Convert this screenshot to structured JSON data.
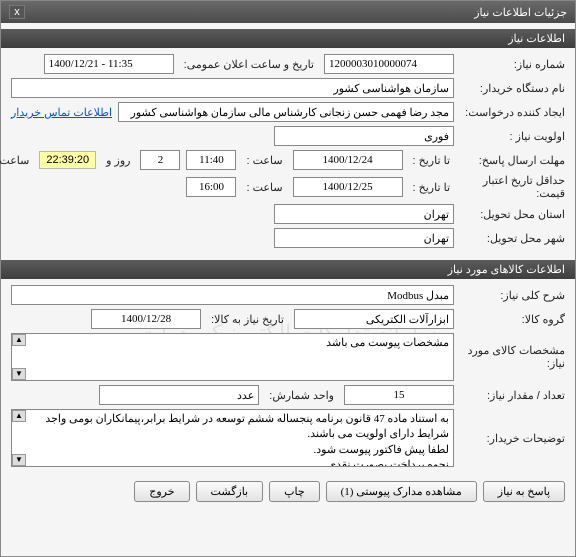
{
  "window": {
    "title": "جزئیات اطلاعات نیاز",
    "close": "x"
  },
  "section1": {
    "title": "اطلاعات نیاز"
  },
  "fields": {
    "need_no_label": "شماره نیاز:",
    "need_no": "1200003010000074",
    "announce_label": "تاریخ و ساعت اعلان عمومی:",
    "announce": "1400/12/21 - 11:35",
    "org_label": "نام دستگاه خریدار:",
    "org": "سازمان هواشناسی کشور",
    "requester_label": "ایجاد کننده درخواست:",
    "requester": "مجد رضا فهمی حسن زنجانی کارشناس مالی سازمان هواشناسی کشور",
    "contact_link": "اطلاعات تماس خریدار",
    "priority_label": "اولویت نیاز :",
    "priority": "فوری",
    "deadline_send_label": "مهلت ارسال پاسخ:",
    "to_date_label": "تا تاریخ :",
    "deadline_date": "1400/12/24",
    "time_label": "ساعت :",
    "deadline_time": "11:40",
    "days": "2",
    "days_and": "روز و",
    "countdown": "22:39:20",
    "remain_label": "ساعت باقی مانده",
    "valid_label": "حداقل تاریخ اعتبار قیمت:",
    "valid_date": "1400/12/25",
    "valid_time": "16:00",
    "deliver_province_label": "استان محل تحویل:",
    "deliver_province": "تهران",
    "deliver_city_label": "شهر محل تحویل:",
    "deliver_city": "تهران"
  },
  "section2": {
    "title": "اطلاعات کالاهای مورد نیاز"
  },
  "goods": {
    "desc_label": "شرح کلی نیاز:",
    "desc": "مبدل Modbus",
    "group_label": "گروه کالا:",
    "group": "ابزارآلات الکتریکی",
    "need_date_label": "تاریخ نیاز به کالا:",
    "need_date": "1400/12/28",
    "spec_label": "مشخصات کالای مورد نیاز:",
    "spec": "مشخصات پیوست می باشد",
    "qty_label": "تعداد / مقدار نیاز:",
    "qty": "15",
    "unit_label": "واحد شمارش:",
    "unit": "عدد",
    "buyer_notes_label": "توضیحات خریدار:",
    "buyer_notes": "به استناد ماده 47 قانون برنامه پنجساله ششم توسعه در شرایط برابر،پیمانکاران بومی واجد شرایط دارای اولویت می باشند.\nلطفا پیش فاکتور پیوست شود.\nنحوه پرداخت بصورت نقدی"
  },
  "buttons": {
    "respond": "پاسخ به نیاز",
    "attachments": "مشاهده مدارک پیوستی (1)",
    "print": "چاپ",
    "back": "بازگشت",
    "exit": "خروج"
  },
  "watermark": "سامانه تدارکات الکترونیکی دولت"
}
